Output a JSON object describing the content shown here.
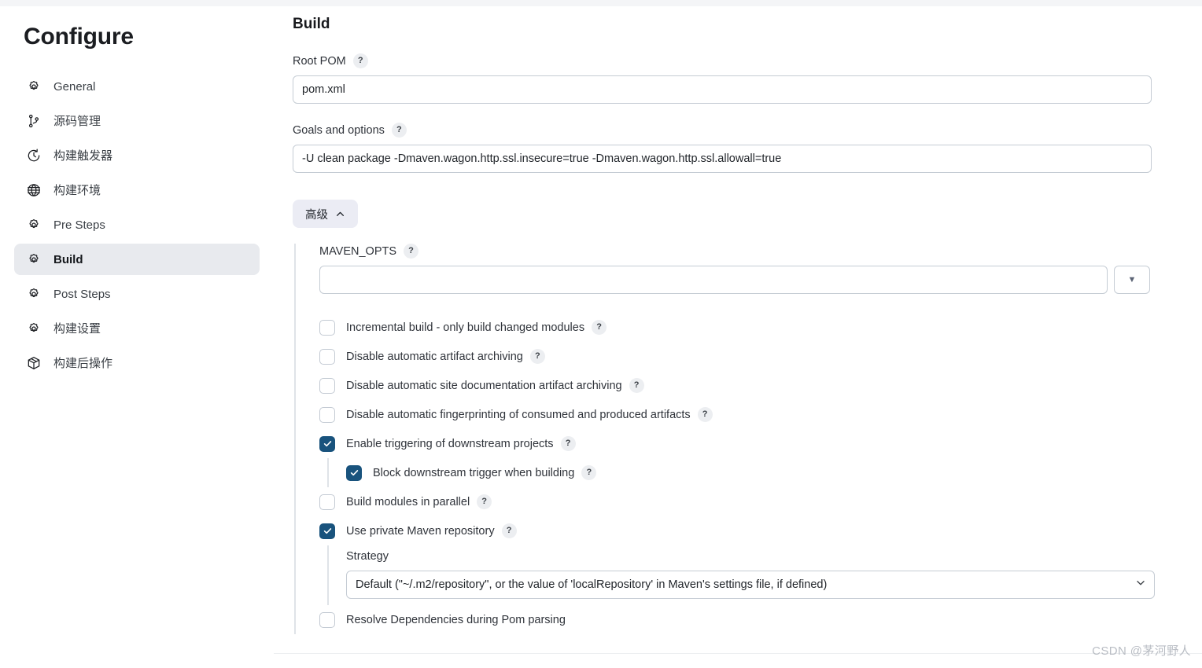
{
  "sidebar": {
    "title": "Configure",
    "items": [
      {
        "label": "General",
        "icon": "gear-icon",
        "active": false
      },
      {
        "label": "源码管理",
        "icon": "git-branch-icon",
        "active": false
      },
      {
        "label": "构建触发器",
        "icon": "clock-icon",
        "active": false
      },
      {
        "label": "构建环境",
        "icon": "globe-icon",
        "active": false
      },
      {
        "label": "Pre Steps",
        "icon": "gear-icon",
        "active": false
      },
      {
        "label": "Build",
        "icon": "gear-icon",
        "active": true
      },
      {
        "label": "Post Steps",
        "icon": "gear-icon",
        "active": false
      },
      {
        "label": "构建设置",
        "icon": "gear-icon",
        "active": false
      },
      {
        "label": "构建后操作",
        "icon": "package-icon",
        "active": false
      }
    ]
  },
  "main": {
    "heading": "Build",
    "root_pom": {
      "label": "Root POM",
      "help": "?",
      "value": "pom.xml",
      "placeholder": ""
    },
    "goals": {
      "label": "Goals and options",
      "help": "?",
      "value": "-U clean package -Dmaven.wagon.http.ssl.insecure=true -Dmaven.wagon.http.ssl.allowall=true",
      "placeholder": ""
    },
    "advanced_button": {
      "label": "高级",
      "expanded": true
    },
    "maven_opts": {
      "label": "MAVEN_OPTS",
      "help": "?",
      "value": "",
      "placeholder": "",
      "dropdown_glyph": "▼"
    },
    "checkboxes": [
      {
        "label": "Incremental build - only build changed modules",
        "checked": false,
        "help": "?",
        "nested": false
      },
      {
        "label": "Disable automatic artifact archiving",
        "checked": false,
        "help": "?",
        "nested": false
      },
      {
        "label": "Disable automatic site documentation artifact archiving",
        "checked": false,
        "help": "?",
        "nested": false
      },
      {
        "label": "Disable automatic fingerprinting of consumed and produced artifacts",
        "checked": false,
        "help": "?",
        "nested": false
      },
      {
        "label": "Enable triggering of downstream projects",
        "checked": true,
        "help": "?",
        "nested": false
      },
      {
        "label": "Block downstream trigger when building",
        "checked": true,
        "help": "?",
        "nested": true
      },
      {
        "label": "Build modules in parallel",
        "checked": false,
        "help": "?",
        "nested": false
      },
      {
        "label": "Use private Maven repository",
        "checked": true,
        "help": "?",
        "nested": false
      }
    ],
    "strategy": {
      "label": "Strategy",
      "selected": "Default (\"~/.m2/repository\", or the value of 'localRepository' in Maven's settings file, if defined)"
    },
    "resolve_dependencies": {
      "label": "Resolve Dependencies during Pom parsing",
      "checked": false
    }
  },
  "watermark": "CSDN @茅河野人",
  "colors": {
    "checkbox_checked": "#19537d",
    "sidebar_active_bg": "#e8eaee",
    "advanced_btn_bg": "#ebecf4",
    "input_border": "#c5ccd4"
  }
}
